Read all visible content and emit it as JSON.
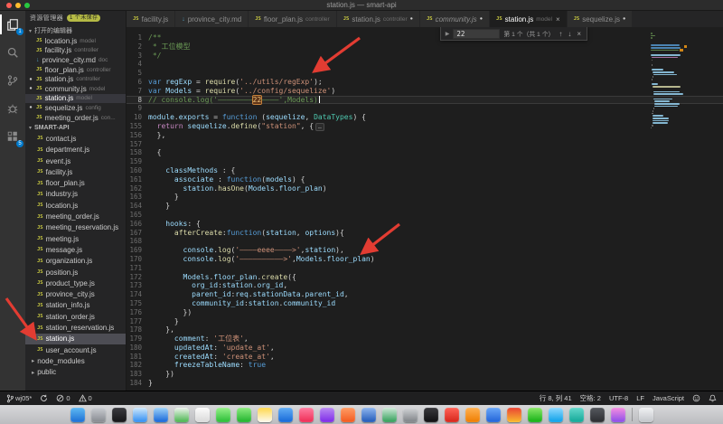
{
  "window": {
    "title": "station.js — smart-api"
  },
  "activity_bar": {
    "explorer_badge": "1",
    "extensions_badge": "5"
  },
  "sidebar": {
    "title": "资源管理器",
    "unsaved_badge": "1 个未保存",
    "open_editors_label": "打开的编辑器",
    "open_editors": [
      {
        "label": "location.js",
        "desc": "model",
        "icon": "js"
      },
      {
        "label": "facility.js",
        "desc": "controller",
        "icon": "js"
      },
      {
        "label": "province_city.md",
        "desc": "doc",
        "icon": "md"
      },
      {
        "label": "floor_plan.js",
        "desc": "controller",
        "icon": "js"
      },
      {
        "label": "station.js",
        "desc": "controller",
        "icon": "js",
        "dirty": true
      },
      {
        "label": "community.js",
        "desc": "model",
        "icon": "js",
        "dirty": true
      },
      {
        "label": "station.js",
        "desc": "model",
        "icon": "js",
        "active": true
      },
      {
        "label": "sequelize.js",
        "desc": "config",
        "icon": "js",
        "dirty": true
      },
      {
        "label": "meeting_order.js",
        "desc": "con...",
        "icon": "js"
      }
    ],
    "project_label": "SMART-API",
    "tree": [
      {
        "label": "contact.js",
        "icon": "js"
      },
      {
        "label": "department.js",
        "icon": "js"
      },
      {
        "label": "event.js",
        "icon": "js"
      },
      {
        "label": "facility.js",
        "icon": "js"
      },
      {
        "label": "floor_plan.js",
        "icon": "js"
      },
      {
        "label": "industry.js",
        "icon": "js"
      },
      {
        "label": "location.js",
        "icon": "js"
      },
      {
        "label": "meeting_order.js",
        "icon": "js"
      },
      {
        "label": "meeting_reservation.js",
        "icon": "js"
      },
      {
        "label": "meeting.js",
        "icon": "js"
      },
      {
        "label": "message.js",
        "icon": "js"
      },
      {
        "label": "organization.js",
        "icon": "js"
      },
      {
        "label": "position.js",
        "icon": "js"
      },
      {
        "label": "product_type.js",
        "icon": "js"
      },
      {
        "label": "province_city.js",
        "icon": "js"
      },
      {
        "label": "station_info.js",
        "icon": "js"
      },
      {
        "label": "station_order.js",
        "icon": "js"
      },
      {
        "label": "station_reservation.js",
        "icon": "js"
      },
      {
        "label": "station.js",
        "icon": "js",
        "selected": true
      },
      {
        "label": "user_account.js",
        "icon": "js"
      },
      {
        "label": "node_modules",
        "icon": "folder"
      },
      {
        "label": "public",
        "icon": "folder"
      }
    ]
  },
  "tabs": [
    {
      "label": "facility.js",
      "icon": "js"
    },
    {
      "label": "province_city.md",
      "icon": "md"
    },
    {
      "label": "floor_plan.js",
      "desc": "controller",
      "icon": "js"
    },
    {
      "label": "station.js",
      "desc": "controller",
      "icon": "js",
      "dirty": true
    },
    {
      "label": "community.js",
      "icon": "js",
      "dirty": true,
      "italic": true
    },
    {
      "label": "station.js",
      "desc": "model",
      "icon": "js",
      "active": true,
      "close": true
    },
    {
      "label": "sequelize.js",
      "icon": "js",
      "dirty": true
    }
  ],
  "find": {
    "query": "22",
    "result_label": "第 1 个（共 1 个）"
  },
  "editor": {
    "lines": [
      {
        "n": "1",
        "t": [
          [
            "/**",
            "c"
          ]
        ]
      },
      {
        "n": "2",
        "t": [
          [
            " * 工位模型",
            "c"
          ]
        ]
      },
      {
        "n": "3",
        "t": [
          [
            " */",
            "c"
          ]
        ]
      },
      {
        "n": "4",
        "t": []
      },
      {
        "n": "5",
        "t": []
      },
      {
        "n": "6",
        "t": [
          [
            "var ",
            "k"
          ],
          [
            "regExp",
            "v"
          ],
          [
            " = ",
            "p"
          ],
          [
            "require",
            "f"
          ],
          [
            "(",
            "p"
          ],
          [
            "'../utils/regExp'",
            "s"
          ],
          [
            ");",
            "p"
          ]
        ]
      },
      {
        "n": "7",
        "t": [
          [
            "var ",
            "k"
          ],
          [
            "Models",
            "v"
          ],
          [
            " = ",
            "p"
          ],
          [
            "require",
            "f"
          ],
          [
            "(",
            "p"
          ],
          [
            "'../config/sequelize'",
            "s"
          ],
          [
            ")",
            "p"
          ]
        ]
      },
      {
        "n": "8",
        "cur": true,
        "caret": true,
        "t": [
          [
            "// console.log('————————",
            "c"
          ],
          [
            "22",
            "m"
          ],
          [
            "————',Models)",
            "c"
          ]
        ]
      },
      {
        "n": "9",
        "t": []
      },
      {
        "n": "10",
        "t": [
          [
            "module",
            "v"
          ],
          [
            ".",
            "p"
          ],
          [
            "exports",
            "v"
          ],
          [
            " = ",
            "p"
          ],
          [
            "function",
            "k"
          ],
          [
            " (",
            "p"
          ],
          [
            "sequelize",
            "v"
          ],
          [
            ", ",
            "p"
          ],
          [
            "DataTypes",
            "cl"
          ],
          [
            ") {",
            "p"
          ]
        ]
      },
      {
        "n": "155",
        "t": [
          [
            "  ",
            "p"
          ],
          [
            "return",
            "ct"
          ],
          [
            " ",
            "p"
          ],
          [
            "sequelize",
            "v"
          ],
          [
            ".",
            "p"
          ],
          [
            "define",
            "f"
          ],
          [
            "(",
            "p"
          ],
          [
            "\"station\"",
            "s"
          ],
          [
            ", {",
            "p"
          ],
          [
            "…",
            "fold"
          ]
        ]
      },
      {
        "n": "156",
        "t": [
          [
            "  },",
            "p"
          ]
        ]
      },
      {
        "n": "157",
        "t": []
      },
      {
        "n": "158",
        "t": [
          [
            "  {",
            "p"
          ]
        ]
      },
      {
        "n": "159",
        "t": []
      },
      {
        "n": "160",
        "t": [
          [
            "    classMethods",
            "v"
          ],
          [
            " : {",
            "p"
          ]
        ]
      },
      {
        "n": "161",
        "t": [
          [
            "      associate",
            "v"
          ],
          [
            " : ",
            "p"
          ],
          [
            "function",
            "k"
          ],
          [
            "(",
            "p"
          ],
          [
            "models",
            "v"
          ],
          [
            ") {",
            "p"
          ]
        ]
      },
      {
        "n": "162",
        "t": [
          [
            "        station",
            "v"
          ],
          [
            ".",
            "p"
          ],
          [
            "hasOne",
            "f"
          ],
          [
            "(",
            "p"
          ],
          [
            "Models",
            "v"
          ],
          [
            ".",
            "p"
          ],
          [
            "floor_plan",
            "v"
          ],
          [
            ")",
            "p"
          ]
        ]
      },
      {
        "n": "163",
        "t": [
          [
            "      }",
            "p"
          ]
        ]
      },
      {
        "n": "164",
        "t": [
          [
            "    }",
            "p"
          ]
        ]
      },
      {
        "n": "165",
        "t": []
      },
      {
        "n": "166",
        "t": [
          [
            "    hooks",
            "v"
          ],
          [
            ": {",
            "p"
          ]
        ]
      },
      {
        "n": "167",
        "t": [
          [
            "      afterCreate",
            "f"
          ],
          [
            ":",
            "p"
          ],
          [
            "function",
            "k"
          ],
          [
            "(",
            "p"
          ],
          [
            "station",
            "v"
          ],
          [
            ", ",
            "p"
          ],
          [
            "options",
            "v"
          ],
          [
            "){",
            "p"
          ]
        ]
      },
      {
        "n": "168",
        "t": []
      },
      {
        "n": "169",
        "t": [
          [
            "        console",
            "v"
          ],
          [
            ".",
            "p"
          ],
          [
            "log",
            "f"
          ],
          [
            "(",
            "p"
          ],
          [
            "'————eeee————>'",
            "s"
          ],
          [
            ",",
            "p"
          ],
          [
            "station",
            "v"
          ],
          [
            "),",
            "p"
          ]
        ]
      },
      {
        "n": "170",
        "t": [
          [
            "        console",
            "v"
          ],
          [
            ".",
            "p"
          ],
          [
            "log",
            "f"
          ],
          [
            "(",
            "p"
          ],
          [
            "'——————————>'",
            "s"
          ],
          [
            ",",
            "p"
          ],
          [
            "Models",
            "v"
          ],
          [
            ".",
            "p"
          ],
          [
            "floor_plan",
            "v"
          ],
          [
            ")",
            "p"
          ]
        ]
      },
      {
        "n": "171",
        "t": []
      },
      {
        "n": "172",
        "t": [
          [
            "        Models",
            "v"
          ],
          [
            ".",
            "p"
          ],
          [
            "floor_plan",
            "v"
          ],
          [
            ".",
            "p"
          ],
          [
            "create",
            "f"
          ],
          [
            "({",
            "p"
          ]
        ]
      },
      {
        "n": "173",
        "t": [
          [
            "          org_id",
            "v"
          ],
          [
            ":",
            "p"
          ],
          [
            "station",
            "v"
          ],
          [
            ".",
            "p"
          ],
          [
            "org_id",
            "v"
          ],
          [
            ",",
            "p"
          ]
        ]
      },
      {
        "n": "174",
        "t": [
          [
            "          parent_id",
            "v"
          ],
          [
            ":",
            "p"
          ],
          [
            "req",
            "v"
          ],
          [
            ".",
            "p"
          ],
          [
            "stationData",
            "v"
          ],
          [
            ".",
            "p"
          ],
          [
            "parent_id",
            "v"
          ],
          [
            ",",
            "p"
          ]
        ]
      },
      {
        "n": "175",
        "t": [
          [
            "          community_id",
            "v"
          ],
          [
            ":",
            "p"
          ],
          [
            "station",
            "v"
          ],
          [
            ".",
            "p"
          ],
          [
            "community_id",
            "v"
          ]
        ]
      },
      {
        "n": "176",
        "t": [
          [
            "        })",
            "p"
          ]
        ]
      },
      {
        "n": "177",
        "t": [
          [
            "      }",
            "p"
          ]
        ]
      },
      {
        "n": "178",
        "t": [
          [
            "    },",
            "p"
          ]
        ]
      },
      {
        "n": "179",
        "t": [
          [
            "      comment",
            "v"
          ],
          [
            ": ",
            "p"
          ],
          [
            "'工位表'",
            "s"
          ],
          [
            ",",
            "p"
          ]
        ]
      },
      {
        "n": "180",
        "t": [
          [
            "      updatedAt",
            "v"
          ],
          [
            ": ",
            "p"
          ],
          [
            "'update_at'",
            "s"
          ],
          [
            ",",
            "p"
          ]
        ]
      },
      {
        "n": "181",
        "t": [
          [
            "      createdAt",
            "v"
          ],
          [
            ": ",
            "p"
          ],
          [
            "'create_at'",
            "s"
          ],
          [
            ",",
            "p"
          ]
        ]
      },
      {
        "n": "182",
        "t": [
          [
            "      freezeTableName",
            "v"
          ],
          [
            ": ",
            "p"
          ],
          [
            "true",
            "k"
          ]
        ]
      },
      {
        "n": "183",
        "t": [
          [
            "    })",
            "p"
          ]
        ]
      },
      {
        "n": "184",
        "t": [
          [
            "}",
            "p"
          ]
        ]
      }
    ]
  },
  "status_bar": {
    "branch": "wj05*",
    "errors": "0",
    "warnings": "0",
    "cursor": "行 8, 列 41",
    "indent": "空格: 2",
    "encoding": "UTF-8",
    "eol": "LF",
    "language": "JavaScript"
  },
  "dock": {
    "icons": [
      {
        "name": "finder",
        "c1": "#5fb9f3",
        "c2": "#1c6fd4"
      },
      {
        "name": "launchpad",
        "c1": "#c9ccd1",
        "c2": "#86898f"
      },
      {
        "name": "siri",
        "c1": "#3b3b40",
        "c2": "#151517"
      },
      {
        "name": "safari",
        "c1": "#cfe8fb",
        "c2": "#2f8df2"
      },
      {
        "name": "mail",
        "c1": "#9ed2f8",
        "c2": "#1565d8"
      },
      {
        "name": "maps",
        "c1": "#eef3ee",
        "c2": "#47b54c"
      },
      {
        "name": "photos",
        "c1": "#fbfbfb",
        "c2": "#d9d9d9"
      },
      {
        "name": "messages",
        "c1": "#97f08a",
        "c2": "#28bd35"
      },
      {
        "name": "facetime",
        "c1": "#8deb80",
        "c2": "#1fb32c"
      },
      {
        "name": "notes",
        "c1": "#ffd84d",
        "c2": "#fcf9ef"
      },
      {
        "name": "app-store",
        "c1": "#62aef5",
        "c2": "#1668d8"
      },
      {
        "name": "music",
        "c1": "#ff7da0",
        "c2": "#ef2d55"
      },
      {
        "name": "podcasts",
        "c1": "#b98af2",
        "c2": "#7d2ae8"
      },
      {
        "name": "books",
        "c1": "#ff9d66",
        "c2": "#f25a1f"
      },
      {
        "name": "xcode",
        "c1": "#8fb6ee",
        "c2": "#2059b8"
      },
      {
        "name": "android-studio",
        "c1": "#cfe9d8",
        "c2": "#2f9e57"
      },
      {
        "name": "system-preferences",
        "c1": "#d2d4d7",
        "c2": "#7e8287"
      },
      {
        "name": "terminal",
        "c1": "#39393d",
        "c2": "#101012"
      },
      {
        "name": "red-app",
        "c1": "#ff6458",
        "c2": "#d6251a"
      },
      {
        "name": "orange-app",
        "c1": "#ffb152",
        "c2": "#ef7d00"
      },
      {
        "name": "blue-app",
        "c1": "#6aa8f8",
        "c2": "#2163d8"
      },
      {
        "name": "chrome",
        "c1": "#e94435",
        "c2": "#f9bb2d"
      },
      {
        "name": "wechat",
        "c1": "#8ae768",
        "c2": "#12b014"
      },
      {
        "name": "qq",
        "c1": "#8fd9ff",
        "c2": "#0aa0e8"
      },
      {
        "name": "teal-app",
        "c1": "#64d8cb",
        "c2": "#12a797"
      },
      {
        "name": "dark-app",
        "c1": "#55585e",
        "c2": "#2b2d31"
      },
      {
        "name": "purple-app",
        "c1": "#f58ee0",
        "c2": "#8a4de8"
      },
      {
        "name": "trash",
        "c1": "#f0f1f3",
        "c2": "#c2c5c9"
      }
    ]
  }
}
